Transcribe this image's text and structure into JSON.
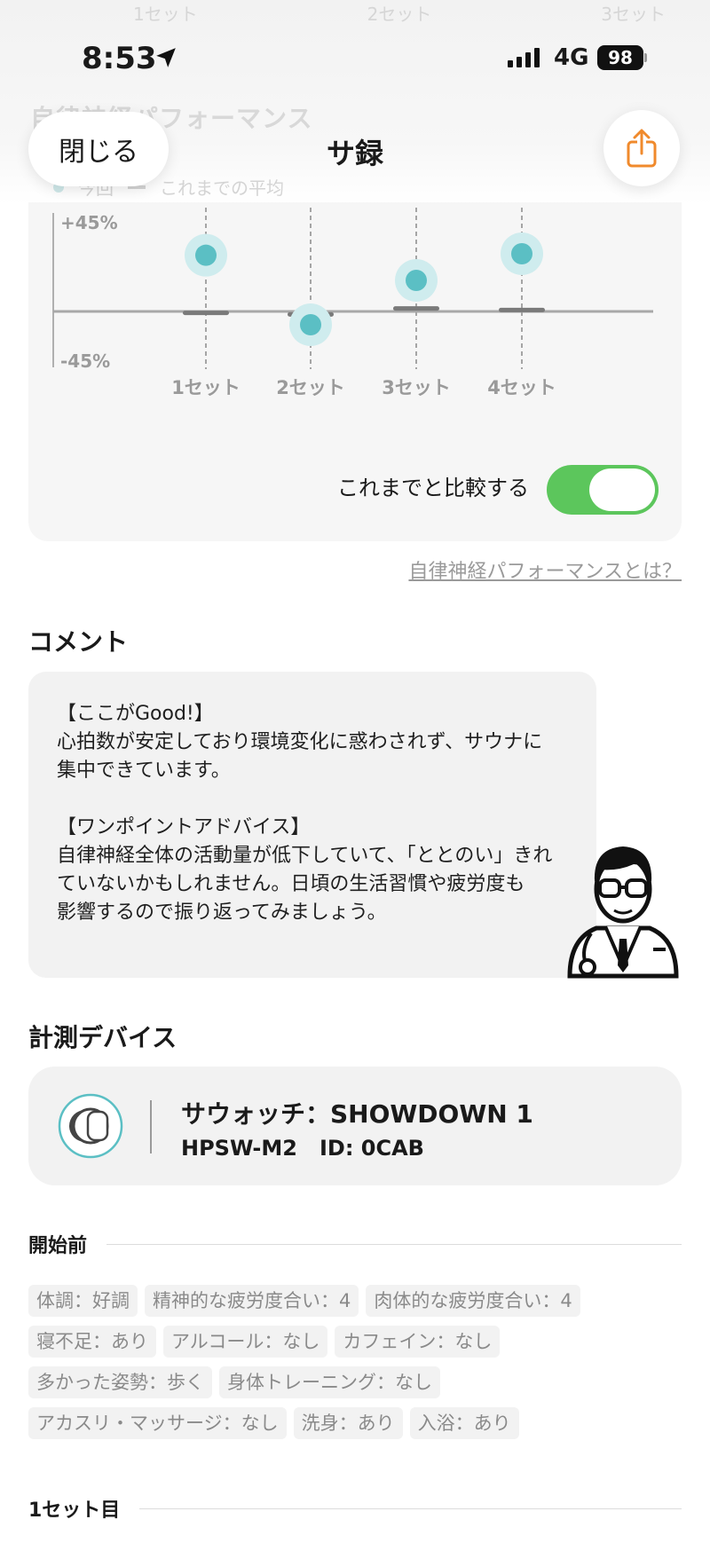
{
  "ghost_header": {
    "columns": [
      "1セット",
      "2セット",
      "3セット"
    ],
    "title": "自律神経パフォーマンス",
    "legend_today": "今回",
    "legend_avg": "これまでの平均"
  },
  "status_bar": {
    "time": "8:53",
    "network": "4G",
    "battery": "98"
  },
  "nav": {
    "close_label": "閉じる",
    "title": "サ録"
  },
  "chart_data": {
    "type": "scatter",
    "categories": [
      "1セット",
      "2セット",
      "3セット",
      "4セット"
    ],
    "series": [
      {
        "name": "今回",
        "values": [
          38,
          -9,
          21,
          39
        ]
      },
      {
        "name": "これまでの平均",
        "values": [
          -1,
          -2,
          2,
          1
        ]
      }
    ],
    "ylim": [
      -45,
      45
    ],
    "y_tick_labels": [
      "+45%",
      "-45%"
    ],
    "colors": {
      "today": "#5bbfc4",
      "today_halo": "#cfecee",
      "avg": "#7a7a7a"
    }
  },
  "compare_toggle": {
    "label": "これまでと比較する",
    "on": true,
    "color": "#5cc65c"
  },
  "info_link": "自律神経パフォーマンスとは？",
  "comment_section": {
    "title": "コメント",
    "lines": [
      "【ここがGood!】",
      "心拍数が安定しており環境変化に惑わされず、サウナに",
      "集中できています。",
      "",
      "【ワンポイントアドバイス】",
      "自律神経全体の活動量が低下していて、「ととのい」きれ",
      "ていないかもしれません。日頃の生活習慣や疲労度も",
      "影響するので振り返ってみましょう。"
    ]
  },
  "device_section": {
    "title": "計測デバイス",
    "name": "サウォッチ：SHOWDOWN 1",
    "id_line": "HPSW-M2   ID: 0CAB"
  },
  "before_section": {
    "title": "開始前",
    "tag_rows": [
      [
        "体調：好調",
        "精神的な疲労度合い：4",
        "肉体的な疲労度合い：4"
      ],
      [
        "寝不足：あり",
        "アルコール：なし",
        "カフェイン：なし"
      ],
      [
        "多かった姿勢：歩く",
        "身体トレーニング：なし"
      ],
      [
        "アカスリ・マッサージ：なし",
        "洗身：あり",
        "入浴：あり"
      ]
    ]
  },
  "set1_section": {
    "title": "1セット目"
  }
}
